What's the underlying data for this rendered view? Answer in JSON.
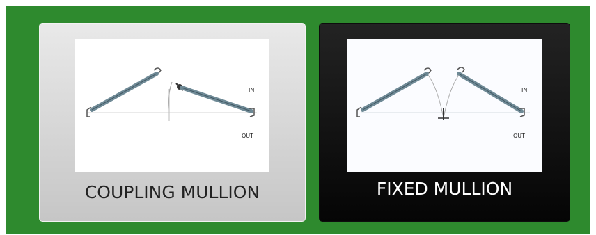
{
  "options": [
    {
      "label": "COUPLING MULLION",
      "diagram": {
        "in_label": "IN",
        "out_label": "OUT",
        "icon": "coupling-mullion-diagram-icon"
      },
      "state": "unselected"
    },
    {
      "label": "FIXED MULLION",
      "diagram": {
        "in_label": "IN",
        "out_label": "OUT",
        "icon": "fixed-mullion-diagram-icon"
      },
      "state": "selected"
    }
  ],
  "colors": {
    "panel_background": "#2e8a2e",
    "unselected_card": "#d9d9d9",
    "selected_card": "#111111",
    "frame_profile": "#6f8a96"
  }
}
